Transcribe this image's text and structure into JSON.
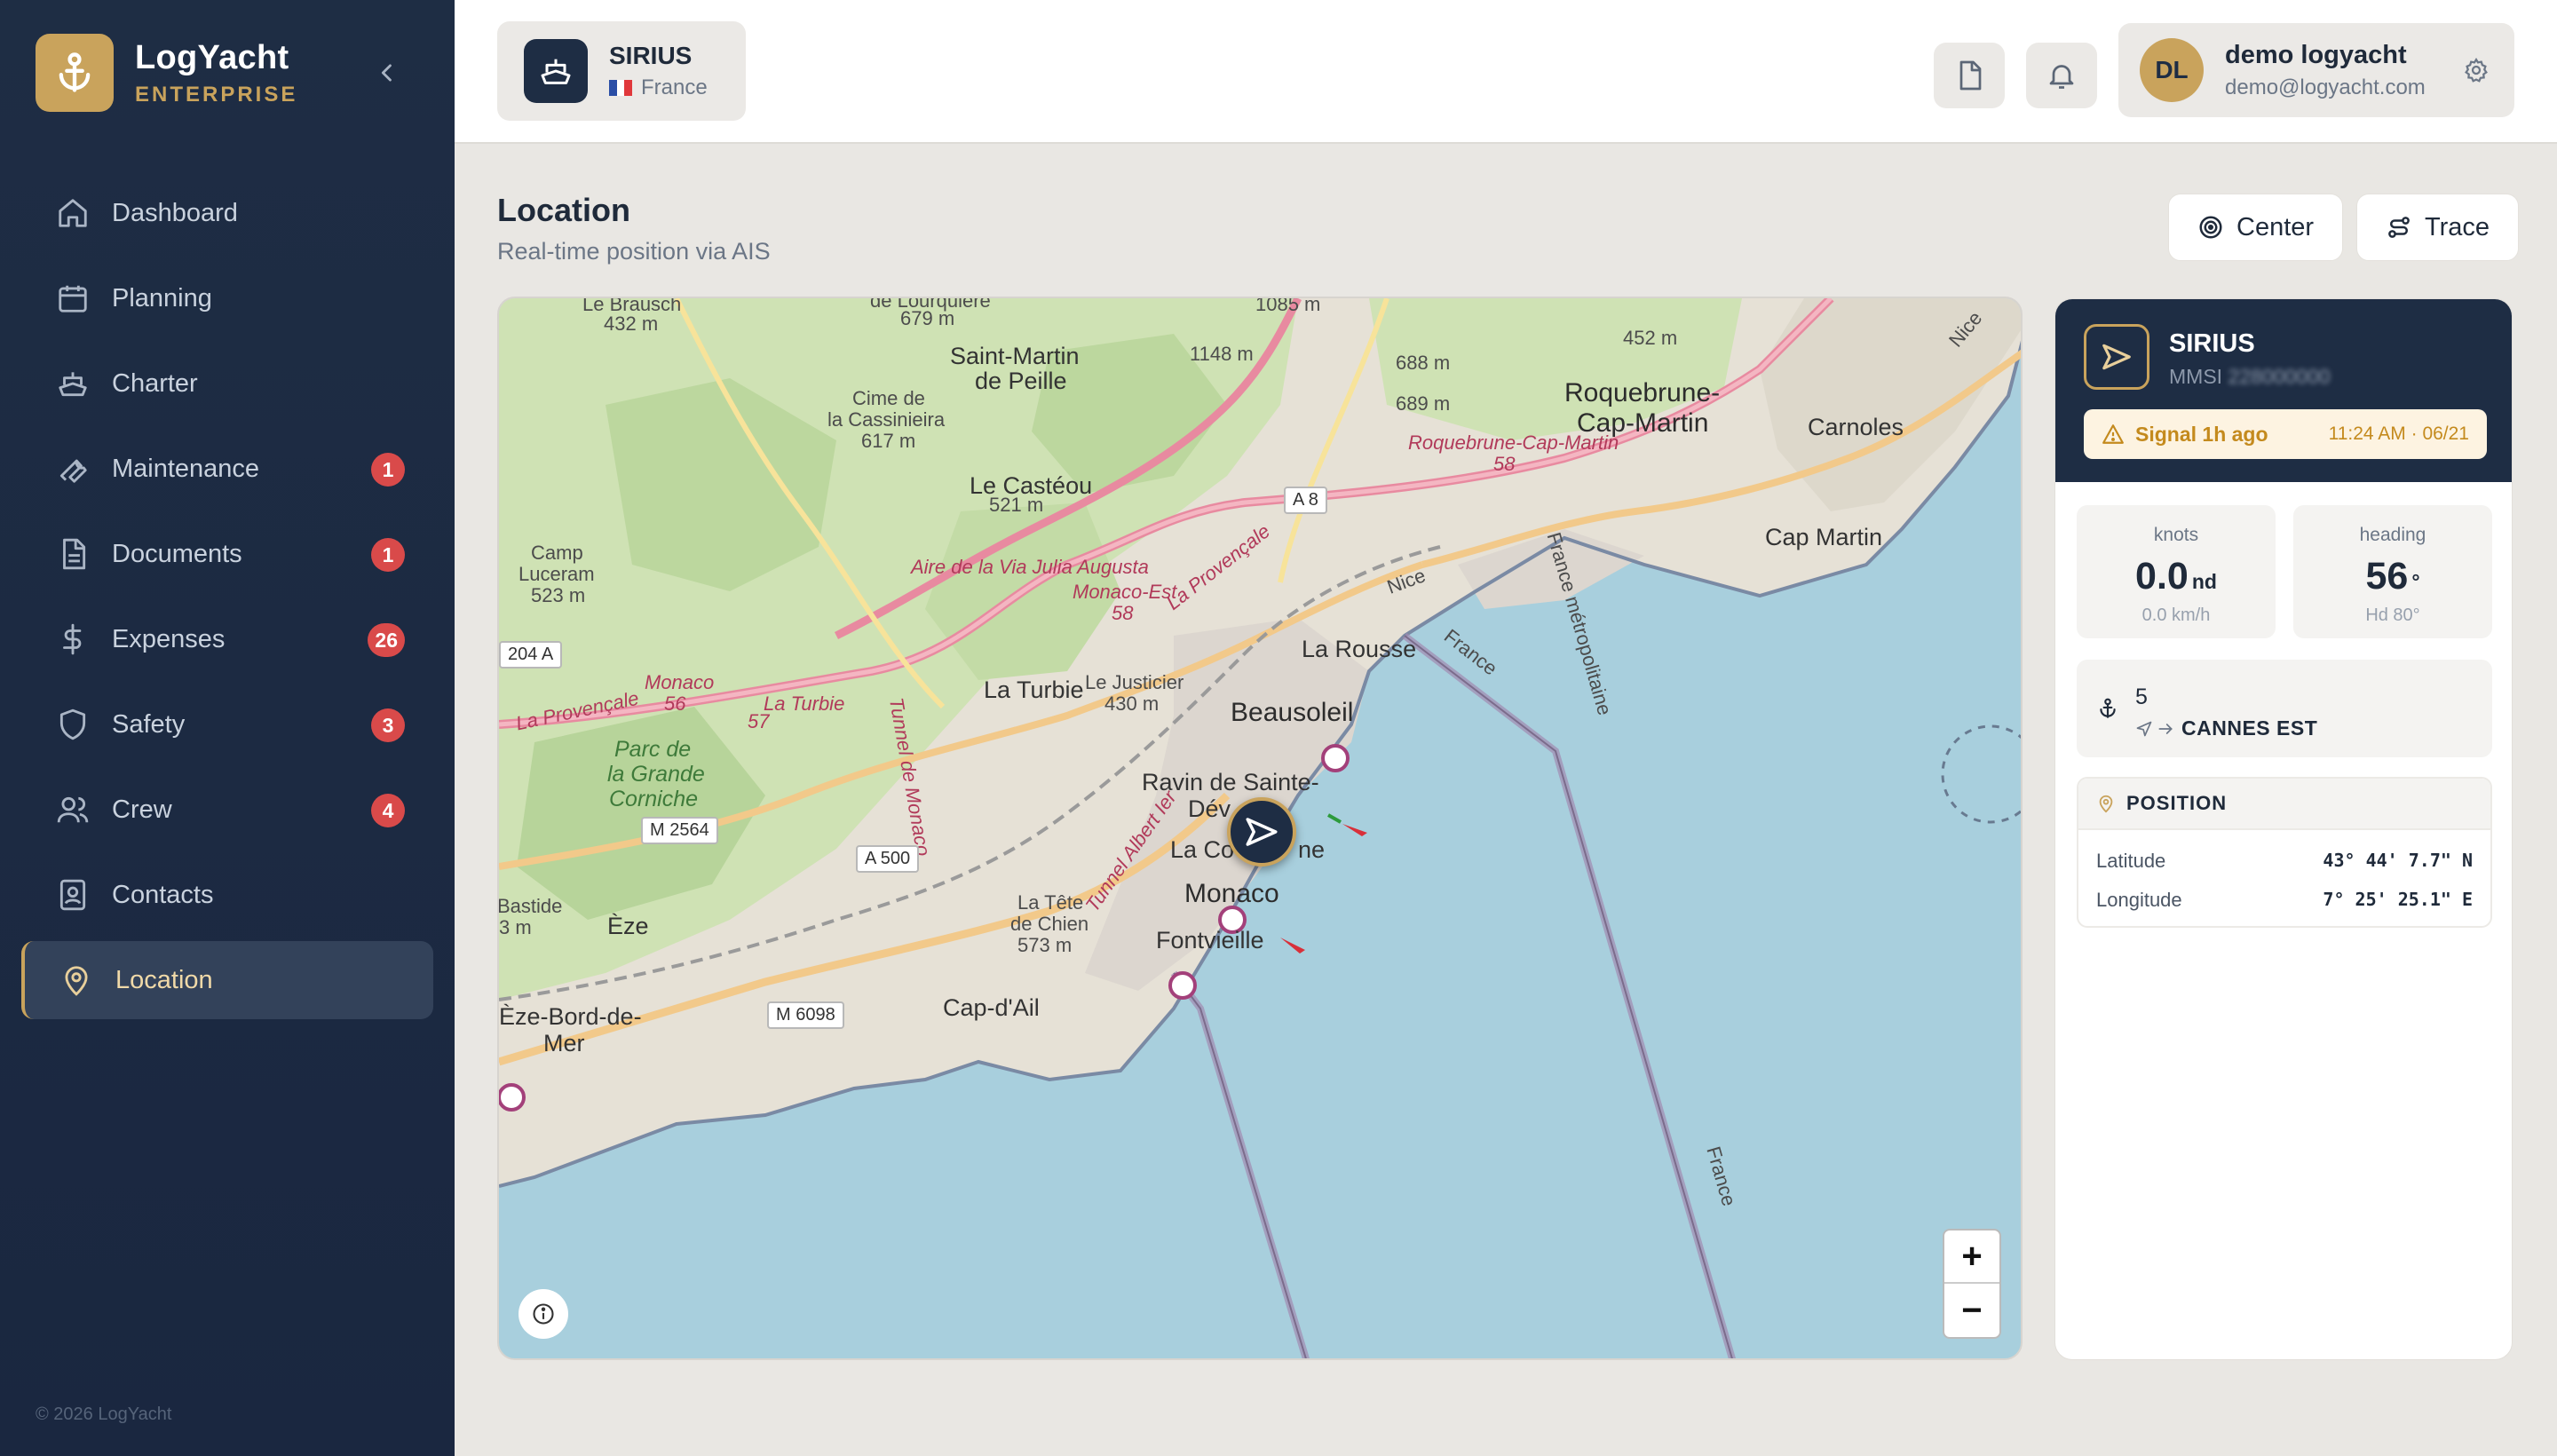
{
  "brand": {
    "name": "LogYacht",
    "edition": "ENTERPRISE"
  },
  "nav": [
    {
      "label": "Dashboard",
      "icon": "home-icon",
      "badge": null
    },
    {
      "label": "Planning",
      "icon": "calendar-icon",
      "badge": null
    },
    {
      "label": "Charter",
      "icon": "ship-icon",
      "badge": null
    },
    {
      "label": "Maintenance",
      "icon": "wrench-icon",
      "badge": "1"
    },
    {
      "label": "Documents",
      "icon": "document-icon",
      "badge": "1"
    },
    {
      "label": "Expenses",
      "icon": "dollar-icon",
      "badge": "26"
    },
    {
      "label": "Safety",
      "icon": "shield-icon",
      "badge": "3"
    },
    {
      "label": "Crew",
      "icon": "users-icon",
      "badge": "4"
    },
    {
      "label": "Contacts",
      "icon": "contact-card-icon",
      "badge": null
    },
    {
      "label": "Location",
      "icon": "map-pin-icon",
      "badge": null,
      "active": true
    }
  ],
  "copyright": "© 2026 LogYacht",
  "vessel": {
    "name": "SIRIUS",
    "country": "France"
  },
  "user": {
    "initials": "DL",
    "name": "demo logyacht",
    "email": "demo@logyacht.com"
  },
  "page": {
    "title": "Location",
    "subtitle": "Real-time position via AIS"
  },
  "actions": {
    "center": "Center",
    "trace": "Trace"
  },
  "map": {
    "zoom_in": "+",
    "zoom_out": "−",
    "labels": {
      "le_brausch": "Le Brausch",
      "alt_432": "432 m",
      "de_lourquiere": "de Lourquière",
      "alt_679": "679 m",
      "alt_1085": "1085 m",
      "saint_martin": "Saint-Martin",
      "de_peille": "de Peille",
      "alt_1148": "1148 m",
      "alt_688": "688 m",
      "alt_689": "689 m",
      "alt_452": "452 m",
      "nice": "Nice",
      "cime": "Cime de",
      "cassinieira": "la Cassinieira",
      "alt_617": "617 m",
      "roquebrune": "Roquebrune-",
      "cap_martin_town": "Cap-Martin",
      "carnoles": "Carnoles",
      "roquebrune_road": "Roquebrune-Cap-Martin",
      "road_58a": "58",
      "le_casteou": "Le Castéou",
      "alt_521": "521 m",
      "camp": "Camp",
      "luceram": "Luceram",
      "alt_523": "523 m",
      "aire_via_julia": "Aire de la Via Julia Augusta",
      "monaco_est": "Monaco-Est",
      "la_provencale": "La Provençale",
      "road_58b": "58",
      "cap_martin": "Cap Martin",
      "nice_road": "Nice",
      "road_204a": "204 A",
      "monaco_road": "Monaco",
      "road_56": "56",
      "la_turbie_road": "La Turbie",
      "road_57": "57",
      "la_provencale2": "La Provençale",
      "tunnel": "Tunnel de Monaco",
      "le_justicier": "Le Justicier",
      "alt_430": "430 m",
      "la_turbie": "La Turbie",
      "la_rousse": "La Rousse",
      "france_a": "France",
      "beausoleil": "Beausoleil",
      "parc": "Parc de",
      "la_grande": "la Grande",
      "corniche": "Corniche",
      "ravin": "Ravin de Sainte-",
      "devote": "Dév",
      "tunnel_albert": "Tunnel Albert Ier",
      "la_condamine": "La Co",
      "condamine_end": "ne",
      "france_metro": "France métropolitaine",
      "bastide": "Bastide",
      "alt_3m": "3 m",
      "eze": "Èze",
      "la_tete": "La Tête",
      "de_chien": "de Chien",
      "alt_573": "573 m",
      "monaco": "Monaco",
      "fontvieille": "Fontvieille",
      "cap_dail": "Cap-d'Ail",
      "eze_bord": "Èze-Bord-de-",
      "mer": "Mer",
      "france_b": "France"
    },
    "shields": {
      "a8": "A 8",
      "a500": "A 500",
      "m2564": "M 2564",
      "m6098": "M 6098"
    }
  },
  "panel": {
    "vessel_name": "SIRIUS",
    "mmsi_prefix": "MMSI",
    "mmsi_value": "228000000",
    "signal_text": "Signal 1h ago",
    "signal_time": "11:24 AM · 06/21",
    "speed": {
      "label": "knots",
      "value": "0.0",
      "unit": "nd",
      "sub": "0.0 km/h"
    },
    "heading": {
      "label": "heading",
      "value": "56",
      "unit": "°",
      "sub": "Hd 80°"
    },
    "destination": {
      "number": "5",
      "name": "CANNES EST"
    },
    "position": {
      "title": "POSITION",
      "lat_label": "Latitude",
      "lat_value": "43° 44' 7.7\" N",
      "lon_label": "Longitude",
      "lon_value": "7° 25' 25.1\" E"
    }
  },
  "colors": {
    "navy": "#1e2d44",
    "gold": "#c9a35c",
    "badge_red": "#d94a4a",
    "warning": "#c48a1d",
    "sea": "#a8cfdd"
  }
}
